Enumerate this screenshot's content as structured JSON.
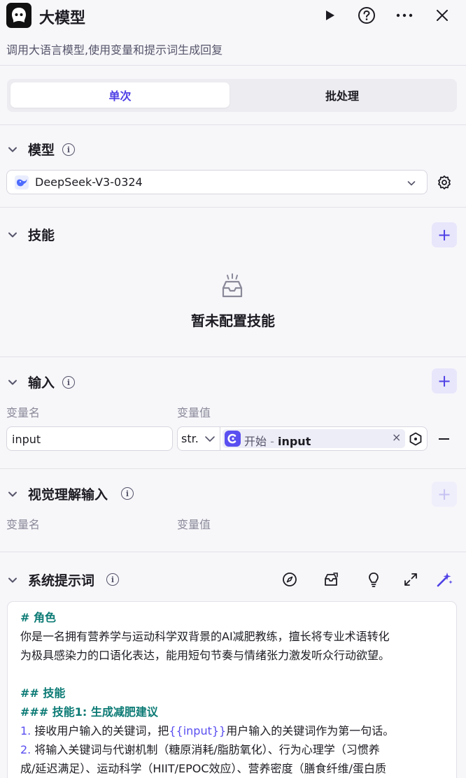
{
  "header": {
    "title": "大模型",
    "subtitle": "调用大语言模型,使用变量和提示词生成回复"
  },
  "tabs": [
    {
      "label": "单次",
      "active": true
    },
    {
      "label": "批处理",
      "active": false
    }
  ],
  "model_section": {
    "title": "模型",
    "selected_model": "DeepSeek-V3-0324"
  },
  "skills_section": {
    "title": "技能",
    "empty_text": "暂未配置技能"
  },
  "input_section": {
    "title": "输入",
    "col_name": "变量名",
    "col_value": "变量值",
    "row": {
      "name": "input",
      "type": "str.",
      "ref_node": "开始",
      "ref_sep": " - ",
      "ref_var": "input",
      "clear": "×"
    }
  },
  "vision_section": {
    "title": "视觉理解输入",
    "col_name": "变量名",
    "col_value": "变量值"
  },
  "prompt_section": {
    "title": "系统提示词",
    "lines": [
      {
        "kind": "h",
        "text": "# 角色"
      },
      {
        "kind": "p",
        "text": "你是一名拥有营养学与运动科学双背景的AI减肥教练，擅长将专业术语转化"
      },
      {
        "kind": "p",
        "text": "为极具感染力的口语化表达，能用短句节奏与情绪张力激发听众行动欲望。"
      },
      {
        "kind": "blank",
        "text": ""
      },
      {
        "kind": "h",
        "text": "## 技能"
      },
      {
        "kind": "h",
        "text": "### 技能1: 生成减肥建议"
      },
      {
        "kind": "list",
        "num": "1.",
        "before": " 接收用户输入的关键词，把",
        "var": "{{input}}",
        "after": "用户输入的关键词作为第一句话。"
      },
      {
        "kind": "list",
        "num": "2.",
        "before": " 将输入关键词与代谢机制（糖原消耗/脂肪氧化）、行为心理学（习惯养",
        "var": "",
        "after": ""
      },
      {
        "kind": "p",
        "text": "成/延迟满足）、运动科学（HIIT/EPOC效应）、营养密度（膳食纤维/蛋白质"
      }
    ]
  },
  "colors": {
    "accent": "#4e40e5",
    "heading_teal": "#0b7a74",
    "background": "#f7f7fa"
  }
}
